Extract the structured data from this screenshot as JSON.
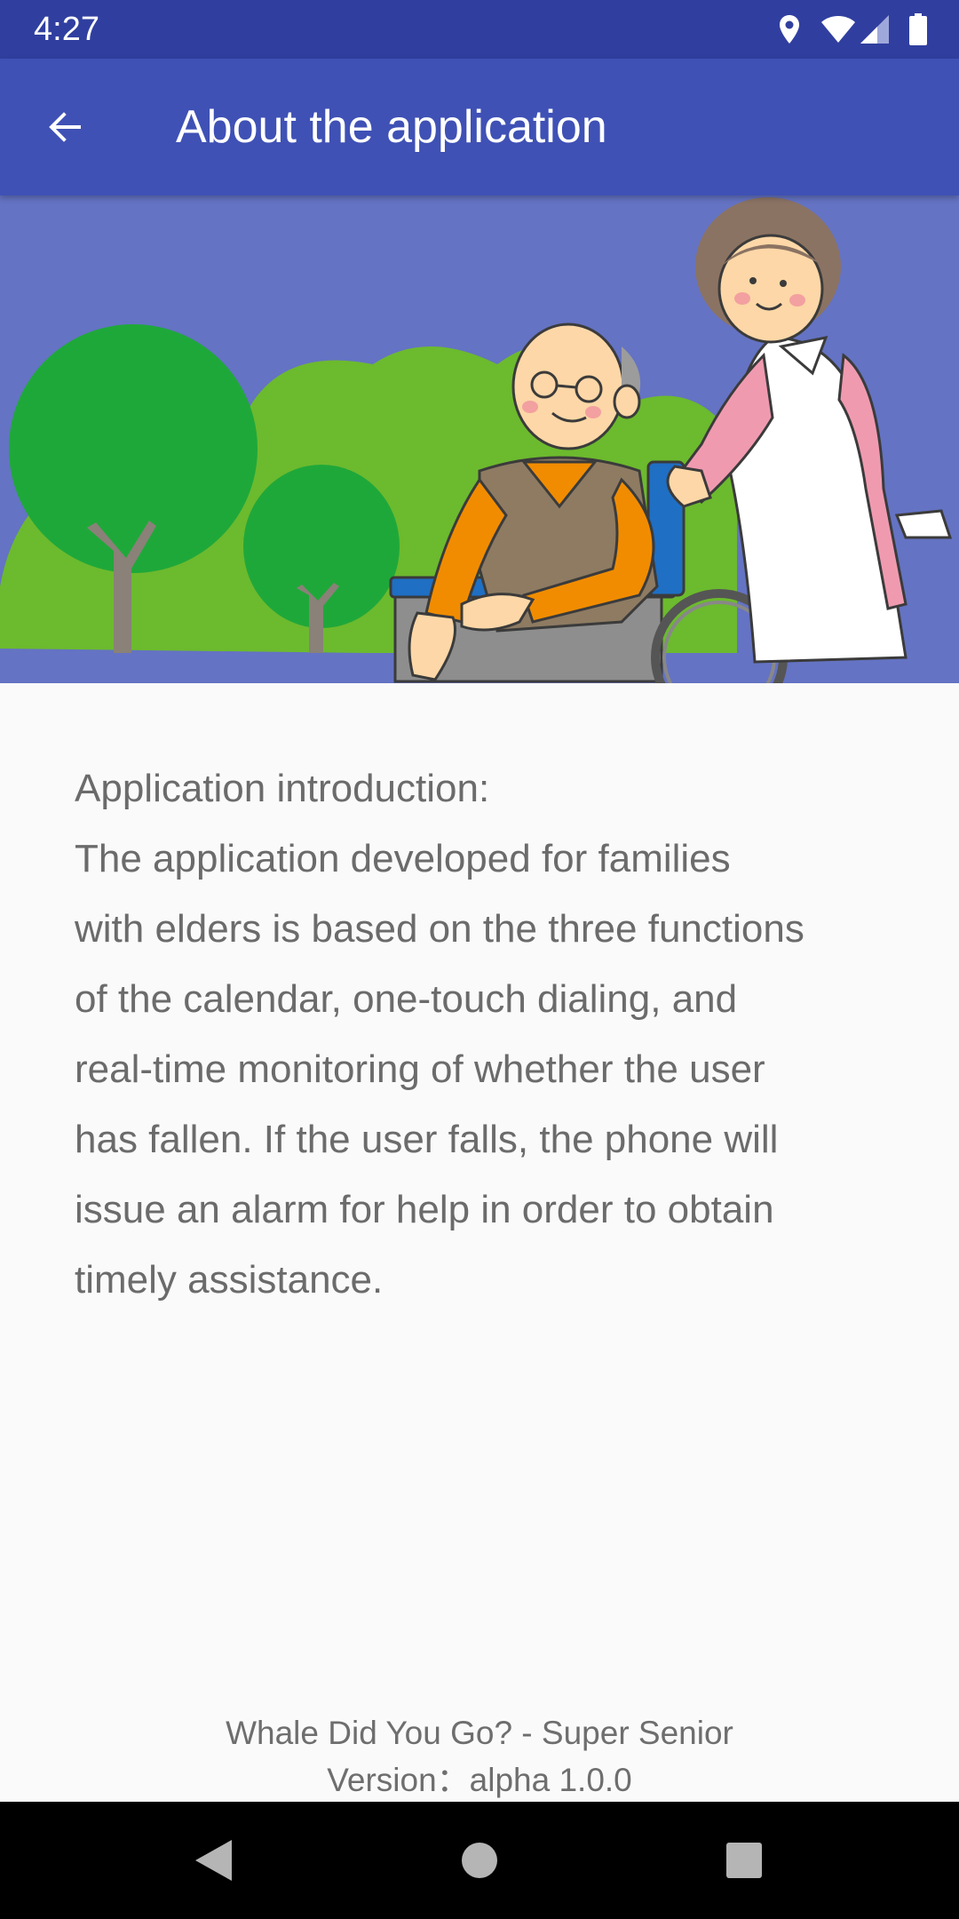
{
  "status_bar": {
    "time": "4:27",
    "icons": [
      "location-icon",
      "wifi-icon",
      "signal-icon",
      "battery-icon"
    ]
  },
  "app_bar": {
    "title": "About the application",
    "back_icon": "arrow-back-icon",
    "color": "#3f51b5"
  },
  "banner": {
    "description_icon": "caregiver-with-elder-in-wheelchair-illustration",
    "background": "#6473c3"
  },
  "content": {
    "heading": "Application introduction:",
    "lines": [
      "The application developed for families",
      "with elders is based on the three functions",
      "of the calendar, one-touch dialing, and",
      "real-time monitoring of whether the user",
      "has fallen. If the user falls, the phone will",
      "issue an alarm for help in order to obtain",
      "timely assistance."
    ]
  },
  "footer": {
    "app_name": "Whale Did You Go? - Super Senior",
    "version": "Version：alpha 1.0.0"
  },
  "nav_bar": {
    "buttons": [
      "back-triangle-icon",
      "home-circle-icon",
      "recents-square-icon"
    ]
  }
}
